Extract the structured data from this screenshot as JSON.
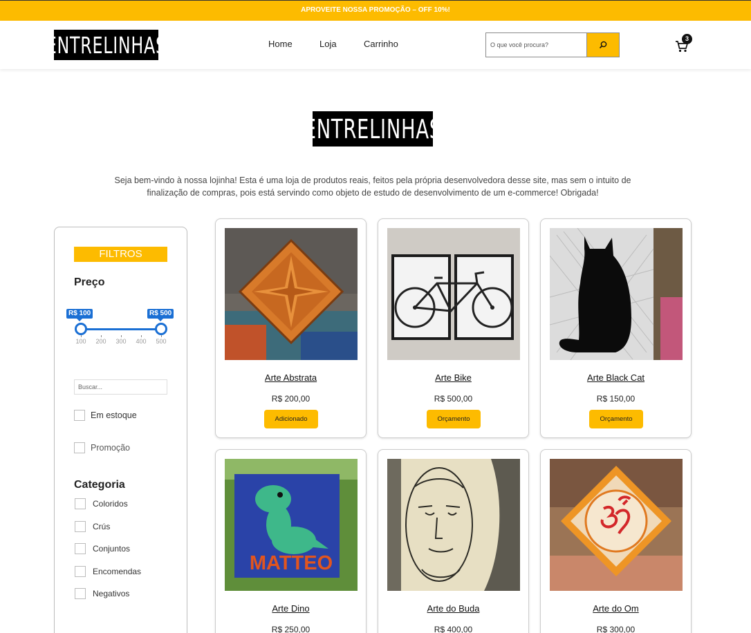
{
  "promo_bar": {
    "text": "APROVEITE NOSSA PROMOÇÃO – OFF 10%!"
  },
  "header": {
    "logo_text": "ENTRELINHAS",
    "nav": [
      "Home",
      "Loja",
      "Carrinho"
    ],
    "search_placeholder": "O que você procura?",
    "cart_count": "3"
  },
  "hero": {
    "logo_text": "ENTRELINHAS",
    "intro_line1": "Seja bem-vindo à nossa lojinha! Esta é uma loja de produtos reais, feitos pela própria desenvolvedora desse site, mas sem o intuito de",
    "intro_line2": "finalização de compras, pois está servindo como objeto de estudo de desenvolvimento de um e-commerce! Obrigada!"
  },
  "sidebar": {
    "filters_title": "FILTROS",
    "price_title": "Preço",
    "price_min_label": "R$ 100",
    "price_max_label": "R$ 500",
    "price_ticks": [
      "100",
      "200",
      "300",
      "400",
      "500"
    ],
    "price_range": {
      "min": 100,
      "max": 500,
      "selected_low": 100,
      "selected_high": 500
    },
    "search_placeholder": "Buscar...",
    "in_stock_label": "Em estoque",
    "promo_label": "Promoção",
    "category_title": "Categoria",
    "categories": [
      "Coloridos",
      "Crús",
      "Conjuntos",
      "Encomendas",
      "Negativos"
    ]
  },
  "products": [
    {
      "title": "Arte Abstrata",
      "price": "R$ 200,00",
      "button": "Adicionado"
    },
    {
      "title": "Arte Bike",
      "price": "R$ 500,00",
      "button": "Orçamento"
    },
    {
      "title": "Arte Black Cat",
      "price": "R$ 150,00",
      "button": "Orçamento"
    },
    {
      "title": "Arte Dino",
      "price": "R$ 250,00",
      "image_text": "MATTEO"
    },
    {
      "title": "Arte do Buda",
      "price": "R$ 400,00"
    },
    {
      "title": "Arte do Om",
      "price": "R$ 300,00"
    }
  ],
  "colors": {
    "accent": "#fdbb00",
    "slider": "#1a6fd4",
    "logo_bg": "#000000"
  },
  "icons": {
    "search": "search-icon",
    "cart": "cart-icon"
  }
}
